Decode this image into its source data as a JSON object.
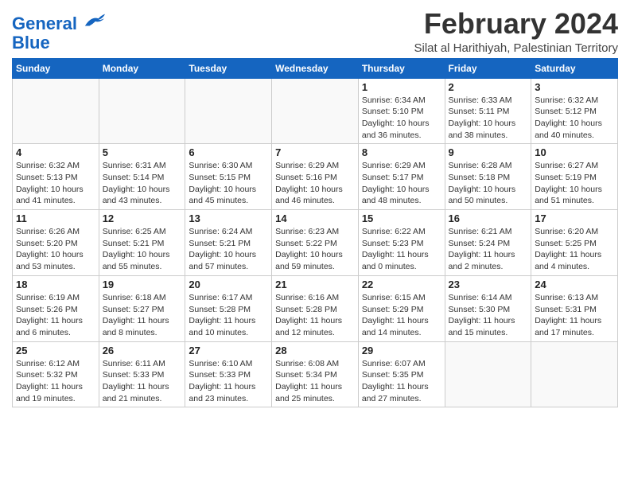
{
  "logo": {
    "line1": "General",
    "line2": "Blue"
  },
  "title": "February 2024",
  "location": "Silat al Harithiyah, Palestinian Territory",
  "days_of_week": [
    "Sunday",
    "Monday",
    "Tuesday",
    "Wednesday",
    "Thursday",
    "Friday",
    "Saturday"
  ],
  "weeks": [
    [
      {
        "num": "",
        "info": ""
      },
      {
        "num": "",
        "info": ""
      },
      {
        "num": "",
        "info": ""
      },
      {
        "num": "",
        "info": ""
      },
      {
        "num": "1",
        "info": "Sunrise: 6:34 AM\nSunset: 5:10 PM\nDaylight: 10 hours\nand 36 minutes."
      },
      {
        "num": "2",
        "info": "Sunrise: 6:33 AM\nSunset: 5:11 PM\nDaylight: 10 hours\nand 38 minutes."
      },
      {
        "num": "3",
        "info": "Sunrise: 6:32 AM\nSunset: 5:12 PM\nDaylight: 10 hours\nand 40 minutes."
      }
    ],
    [
      {
        "num": "4",
        "info": "Sunrise: 6:32 AM\nSunset: 5:13 PM\nDaylight: 10 hours\nand 41 minutes."
      },
      {
        "num": "5",
        "info": "Sunrise: 6:31 AM\nSunset: 5:14 PM\nDaylight: 10 hours\nand 43 minutes."
      },
      {
        "num": "6",
        "info": "Sunrise: 6:30 AM\nSunset: 5:15 PM\nDaylight: 10 hours\nand 45 minutes."
      },
      {
        "num": "7",
        "info": "Sunrise: 6:29 AM\nSunset: 5:16 PM\nDaylight: 10 hours\nand 46 minutes."
      },
      {
        "num": "8",
        "info": "Sunrise: 6:29 AM\nSunset: 5:17 PM\nDaylight: 10 hours\nand 48 minutes."
      },
      {
        "num": "9",
        "info": "Sunrise: 6:28 AM\nSunset: 5:18 PM\nDaylight: 10 hours\nand 50 minutes."
      },
      {
        "num": "10",
        "info": "Sunrise: 6:27 AM\nSunset: 5:19 PM\nDaylight: 10 hours\nand 51 minutes."
      }
    ],
    [
      {
        "num": "11",
        "info": "Sunrise: 6:26 AM\nSunset: 5:20 PM\nDaylight: 10 hours\nand 53 minutes."
      },
      {
        "num": "12",
        "info": "Sunrise: 6:25 AM\nSunset: 5:21 PM\nDaylight: 10 hours\nand 55 minutes."
      },
      {
        "num": "13",
        "info": "Sunrise: 6:24 AM\nSunset: 5:21 PM\nDaylight: 10 hours\nand 57 minutes."
      },
      {
        "num": "14",
        "info": "Sunrise: 6:23 AM\nSunset: 5:22 PM\nDaylight: 10 hours\nand 59 minutes."
      },
      {
        "num": "15",
        "info": "Sunrise: 6:22 AM\nSunset: 5:23 PM\nDaylight: 11 hours\nand 0 minutes."
      },
      {
        "num": "16",
        "info": "Sunrise: 6:21 AM\nSunset: 5:24 PM\nDaylight: 11 hours\nand 2 minutes."
      },
      {
        "num": "17",
        "info": "Sunrise: 6:20 AM\nSunset: 5:25 PM\nDaylight: 11 hours\nand 4 minutes."
      }
    ],
    [
      {
        "num": "18",
        "info": "Sunrise: 6:19 AM\nSunset: 5:26 PM\nDaylight: 11 hours\nand 6 minutes."
      },
      {
        "num": "19",
        "info": "Sunrise: 6:18 AM\nSunset: 5:27 PM\nDaylight: 11 hours\nand 8 minutes."
      },
      {
        "num": "20",
        "info": "Sunrise: 6:17 AM\nSunset: 5:28 PM\nDaylight: 11 hours\nand 10 minutes."
      },
      {
        "num": "21",
        "info": "Sunrise: 6:16 AM\nSunset: 5:28 PM\nDaylight: 11 hours\nand 12 minutes."
      },
      {
        "num": "22",
        "info": "Sunrise: 6:15 AM\nSunset: 5:29 PM\nDaylight: 11 hours\nand 14 minutes."
      },
      {
        "num": "23",
        "info": "Sunrise: 6:14 AM\nSunset: 5:30 PM\nDaylight: 11 hours\nand 15 minutes."
      },
      {
        "num": "24",
        "info": "Sunrise: 6:13 AM\nSunset: 5:31 PM\nDaylight: 11 hours\nand 17 minutes."
      }
    ],
    [
      {
        "num": "25",
        "info": "Sunrise: 6:12 AM\nSunset: 5:32 PM\nDaylight: 11 hours\nand 19 minutes."
      },
      {
        "num": "26",
        "info": "Sunrise: 6:11 AM\nSunset: 5:33 PM\nDaylight: 11 hours\nand 21 minutes."
      },
      {
        "num": "27",
        "info": "Sunrise: 6:10 AM\nSunset: 5:33 PM\nDaylight: 11 hours\nand 23 minutes."
      },
      {
        "num": "28",
        "info": "Sunrise: 6:08 AM\nSunset: 5:34 PM\nDaylight: 11 hours\nand 25 minutes."
      },
      {
        "num": "29",
        "info": "Sunrise: 6:07 AM\nSunset: 5:35 PM\nDaylight: 11 hours\nand 27 minutes."
      },
      {
        "num": "",
        "info": ""
      },
      {
        "num": "",
        "info": ""
      }
    ]
  ]
}
